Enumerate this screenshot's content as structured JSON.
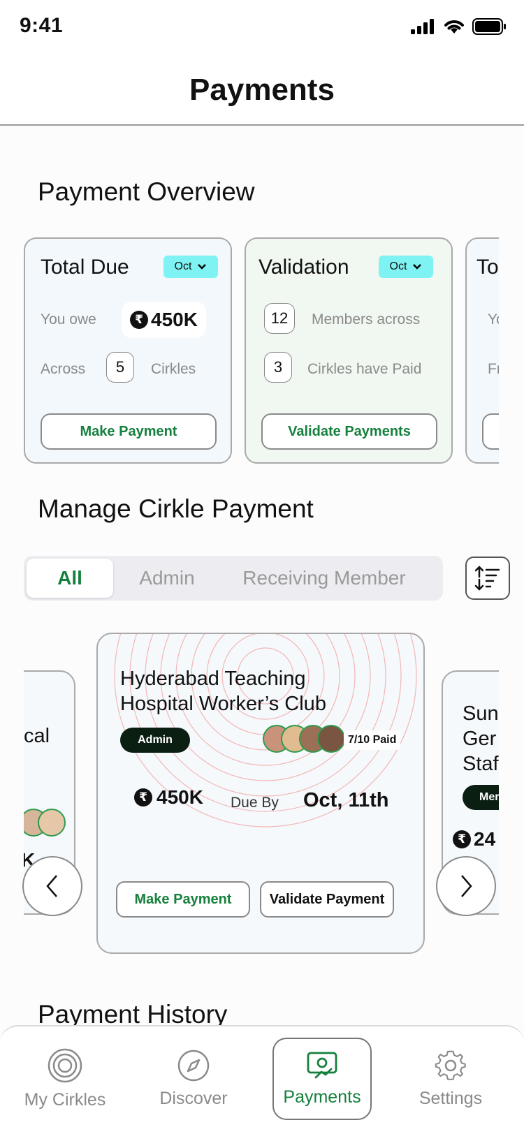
{
  "status_bar": {
    "time": "9:41"
  },
  "header": {
    "title": "Payments"
  },
  "overview": {
    "section_title": "Payment Overview",
    "cards": [
      {
        "title": "Total Due",
        "month": "Oct",
        "owe_label": "You owe",
        "amount": "450K",
        "across_label": "Across",
        "count": "5",
        "count_suffix": "Cirkles",
        "button": "Make Payment"
      },
      {
        "title": "Validation",
        "month": "Oct",
        "members_count": "12",
        "members_label": "Members  across",
        "cirkles_count": "3",
        "cirkles_label": "Cirkles have Paid",
        "button": "Validate Payments"
      },
      {
        "title": "To",
        "line1": "Yo",
        "line2": "Fr"
      }
    ]
  },
  "manage": {
    "section_title": "Manage Cirkle Payment",
    "tabs": [
      "All",
      "Admin",
      "Receiving Member"
    ],
    "active_tab": "All",
    "left_card": {
      "title_fragment": "cal",
      "amount_fragment": "K"
    },
    "main_card": {
      "title": "Hyderabad Teaching Hospital Worker’s Club",
      "role": "Admin",
      "paid": "7/10 Paid",
      "amount": "450K",
      "due_label": "Due By",
      "due_date": "Oct, 11th",
      "make_payment": "Make Payment",
      "validate_payment": "Validate Payment"
    },
    "right_card": {
      "line1": "Sun",
      "line2": "Ger",
      "line3": "Staf",
      "badge": "Mer",
      "amount": "24"
    }
  },
  "history": {
    "section_title": "Payment History"
  },
  "bottom_nav": [
    {
      "label": "My Cirkles",
      "icon": "target-icon"
    },
    {
      "label": "Discover",
      "icon": "compass-icon"
    },
    {
      "label": "Payments",
      "icon": "payment-card-icon"
    },
    {
      "label": "Settings",
      "icon": "gear-icon"
    }
  ],
  "colors": {
    "accent_green": "#15803d",
    "month_pill": "#7ff3f3",
    "admin_badge": "#0b1e12"
  }
}
